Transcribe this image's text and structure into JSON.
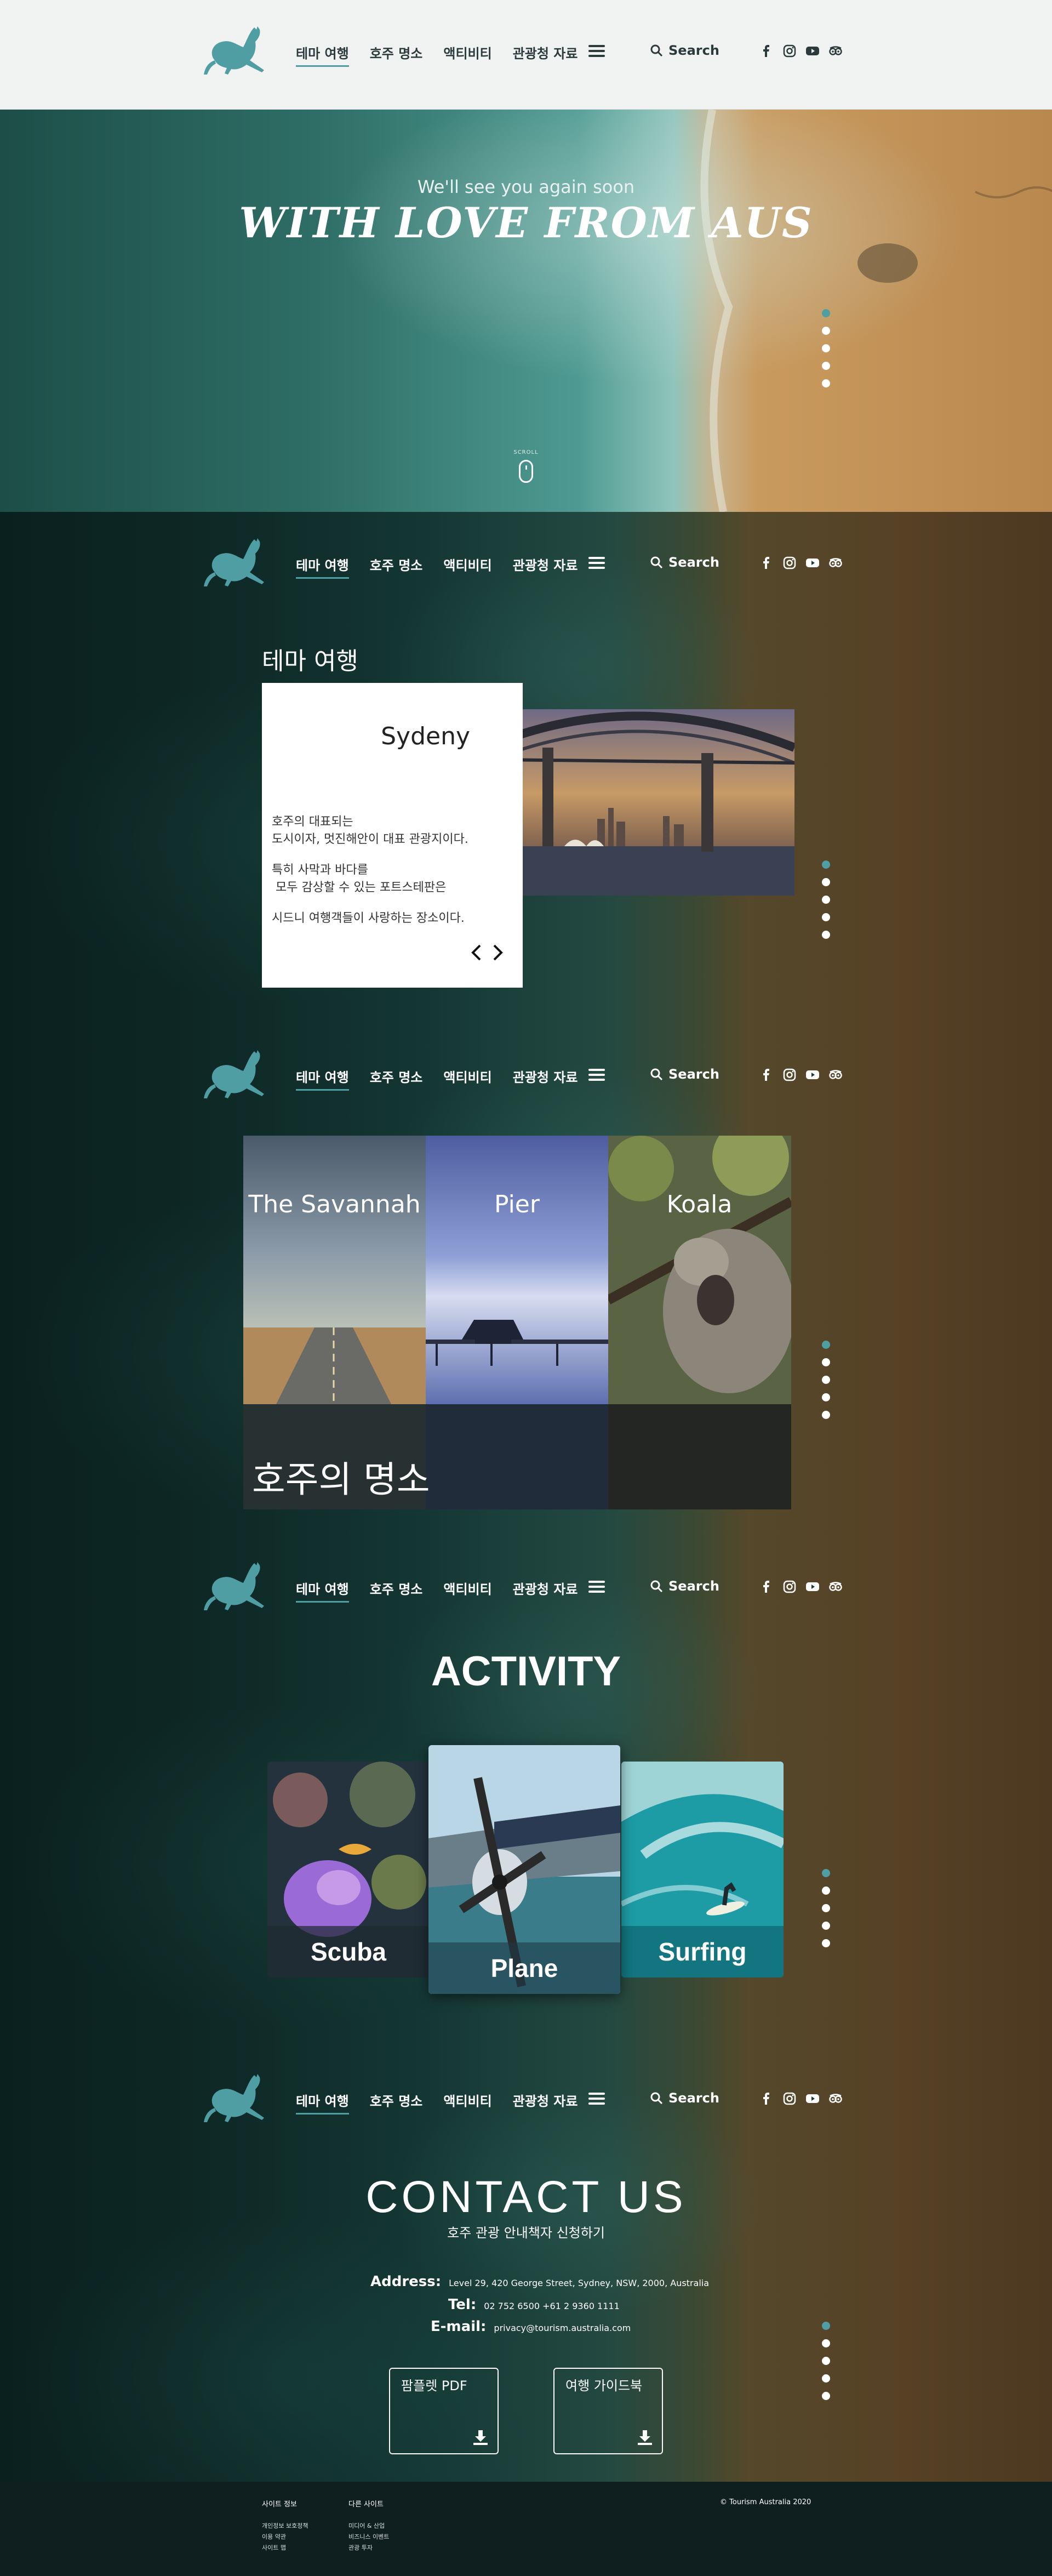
{
  "nav": {
    "items": [
      "테마 여행",
      "호주 명소",
      "액티비티",
      "관광청 자료"
    ],
    "active_index": 0,
    "search_label": "Search",
    "social_icons": [
      "facebook-icon",
      "instagram-icon",
      "youtube-icon",
      "tripadvisor-icon"
    ]
  },
  "hero": {
    "subtitle": "We'll see you again soon",
    "title": "WITH LOVE FROM AUS",
    "scroll_label": "SCROLL"
  },
  "theme": {
    "heading": "테마 여행",
    "city": "Sydeny",
    "desc": [
      "호주의 대표되는",
      "도시이자, 멋진해안이 대표 관광지이다.",
      "특히 사막과 바다를",
      "모두 감상할 수 있는 포트스테판은",
      "시드니 여행객들이 사랑하는 장소이다."
    ]
  },
  "attractions": {
    "items": [
      "The Savannah",
      "Pier",
      "Koala"
    ],
    "heading": "호주의 명소"
  },
  "activity": {
    "title": "ACTIVITY",
    "items": [
      "Scuba",
      "Plane",
      "Surfing"
    ]
  },
  "contact": {
    "title": "CONTACT US",
    "subtitle": "호주 관광 안내책자 신청하기",
    "address_label": "Address:",
    "address": "Level 29, 420 George Street, Sydney, NSW, 2000, Australia",
    "tel_label": "Tel:",
    "tel": "02 752 6500  +61 2 9360 1111",
    "email_label": "E-mail:",
    "email": "privacy@tourism.australia.com",
    "downloads": [
      "팜플렛 PDF",
      "여행 가이드북"
    ]
  },
  "footer": {
    "col1_title": "사이트 정보",
    "col1_links": [
      "개인정보 보호정책",
      "이용 약관",
      "사이트 맵"
    ],
    "col2_title": "다른 사이트",
    "col2_links": [
      "미디어 & 산업",
      "비즈니스 이벤트",
      "관광 투자"
    ],
    "copyright": "© Tourism Australia 2020"
  },
  "pagination": {
    "count": 5,
    "active_index": 0
  },
  "colors": {
    "accent": "#4e9ea3",
    "footer_bg": "#0f1f20",
    "header_light_bg": "#f1f3f3"
  }
}
